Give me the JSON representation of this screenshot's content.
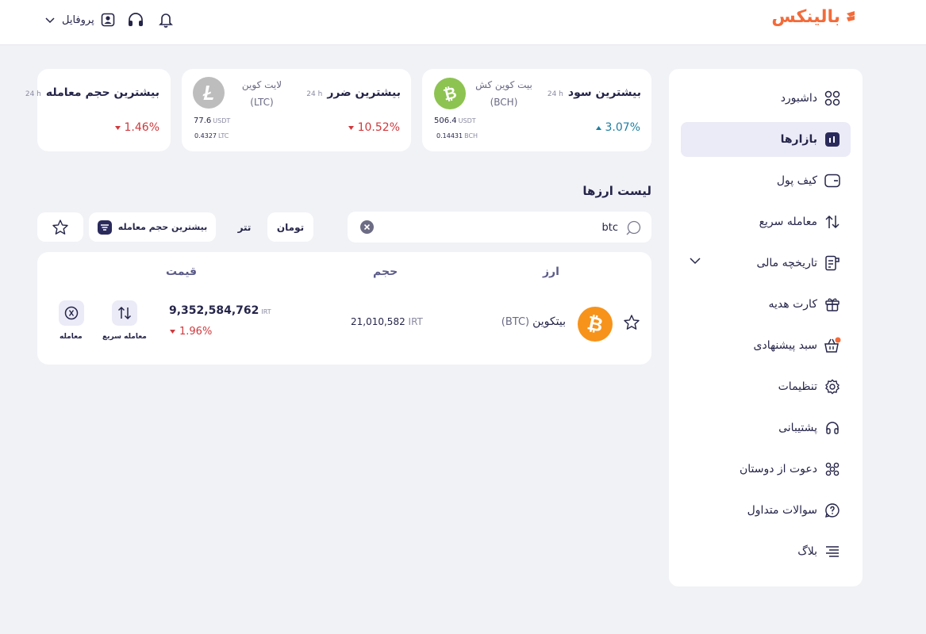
{
  "header": {
    "logo_text": "بالینکس",
    "profile_label": "پروفایل"
  },
  "colors": {
    "brand": "#f26b3a",
    "primary": "#2b2a5c",
    "up": "#1f7fa0",
    "down": "#d0383c",
    "active_bg": "#ebebf7",
    "page_bg": "#f1f2f6"
  },
  "sidebar": {
    "items": [
      {
        "label": "داشبورد",
        "icon": "dashboard-icon"
      },
      {
        "label": "بازارها",
        "icon": "markets-icon",
        "active": true
      },
      {
        "label": "کیف پول",
        "icon": "wallet-icon"
      },
      {
        "label": "معامله سریع",
        "icon": "swap-arrows-icon"
      },
      {
        "label": "تاریخچه مالی",
        "icon": "receipt-icon",
        "expandable": true
      },
      {
        "label": "کارت هدیه",
        "icon": "gift-icon"
      },
      {
        "label": "سبد پیشنهادی",
        "icon": "basket-icon",
        "badge_dot": true
      },
      {
        "label": "تنظیمات",
        "icon": "gear-icon"
      },
      {
        "label": "پشتیبانی",
        "icon": "headset-icon"
      },
      {
        "label": "دعوت از دوستان",
        "icon": "invite-friends-icon"
      },
      {
        "label": "سوالات متداول",
        "icon": "question-icon"
      },
      {
        "label": "بلاگ",
        "icon": "blog-lines-icon"
      }
    ]
  },
  "highlights": [
    {
      "title": "بیشترین سود",
      "period": "24 h",
      "coin_name": "بیت کوین کش",
      "coin_symbol": "(BCH)",
      "coin_icon": "bitcoin-cash-icon",
      "price_value": "506.4",
      "price_unit": "USDT",
      "volume_value": "0.14431",
      "volume_unit": "BCH",
      "change": "3.07%",
      "direction": "up"
    },
    {
      "title": "بیشترین ضرر",
      "period": "24 h",
      "coin_name": "لایت کوین",
      "coin_symbol": "(LTC)",
      "coin_icon": "litecoin-icon",
      "price_value": "77.6",
      "price_unit": "USDT",
      "volume_value": "0.4327",
      "volume_unit": "LTC",
      "change": "10.52%",
      "direction": "down"
    },
    {
      "title": "بیشترین حجم معامله",
      "period": "24 h",
      "change": "1.46%",
      "direction": "down"
    }
  ],
  "list": {
    "title": "لیست ارزها",
    "search_value": "btc",
    "quote_tabs": [
      "تومان",
      "تتر"
    ],
    "selected_tab": "تومان",
    "sort_label": "بیشترین حجم معامله",
    "columns": {
      "currency": "ارز",
      "volume": "حجم",
      "price": "قیمت"
    },
    "rows": [
      {
        "name": "بیتکوین",
        "symbol": "(BTC)",
        "volume": "21,010,582",
        "volume_unit": "IRT",
        "price": "9,352,584,762",
        "price_unit": "IRT",
        "change": "1.96%",
        "direction": "down",
        "quick_trade_label": "معامله سریع",
        "trade_label": "معامله"
      }
    ]
  }
}
